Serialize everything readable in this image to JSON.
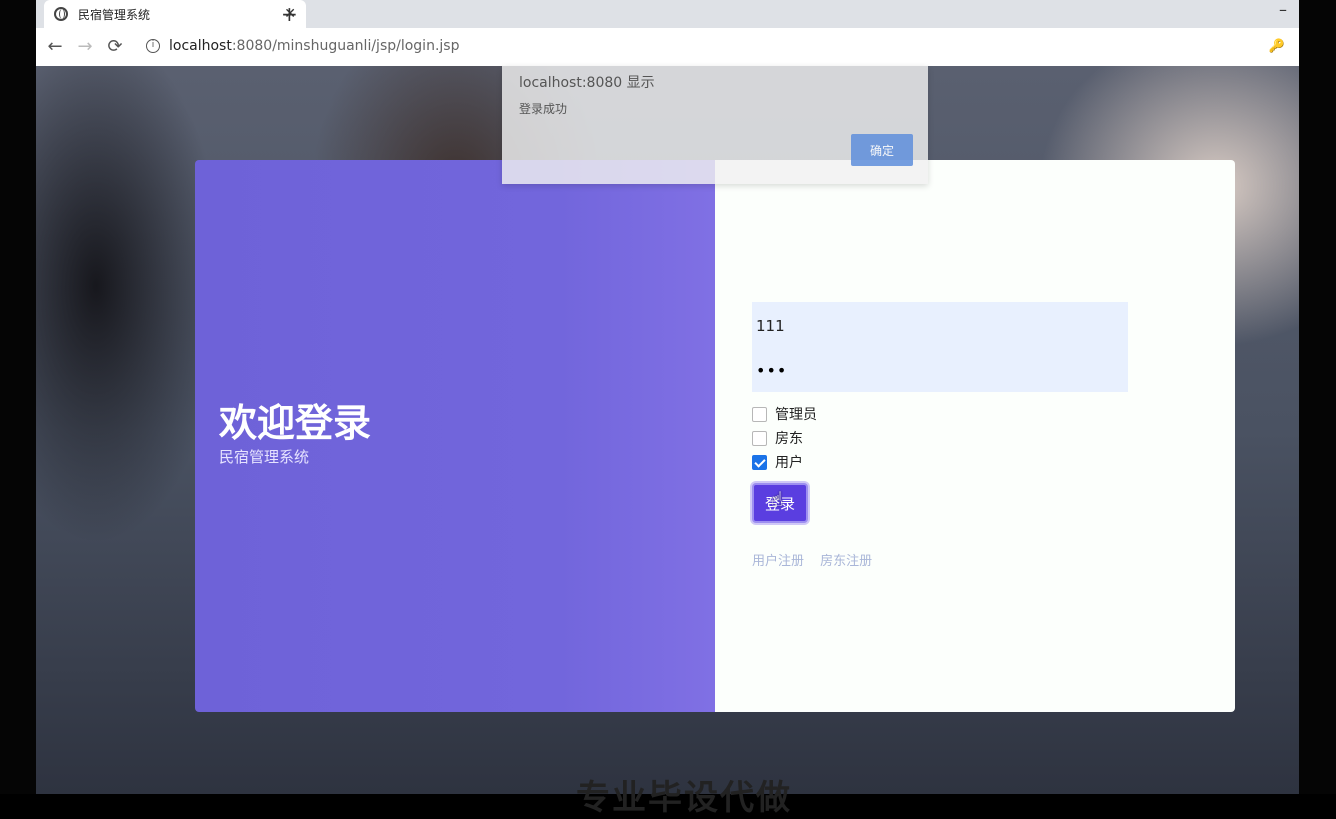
{
  "browser": {
    "tab_title": "民宿管理系统",
    "tab_close": "✕",
    "new_tab": "+",
    "minimize": "–",
    "back": "←",
    "forward": "→",
    "reload": "⟳",
    "info": "i",
    "url_host": "localhost",
    "url_rest": ":8080/minshuguanli/jsp/login.jsp",
    "key": "🔑"
  },
  "alert": {
    "title": "localhost:8080 显示",
    "message": "登录成功",
    "ok_label": "确定"
  },
  "left_panel": {
    "heading": "欢迎登录",
    "subheading": "民宿管理系统"
  },
  "form": {
    "username_value": "111",
    "password_value": "•••",
    "roles": [
      {
        "label": "管理员",
        "checked": false
      },
      {
        "label": "房东",
        "checked": false
      },
      {
        "label": "用户",
        "checked": true
      }
    ],
    "login_label": "登录",
    "links": {
      "user_register": "用户注册",
      "landlord_register": "房东注册"
    }
  },
  "overlay_caption": "专业毕设代做",
  "colors": {
    "panel": "#7266dc",
    "button": "#5a3ee0",
    "checkbox": "#1a73e8"
  }
}
